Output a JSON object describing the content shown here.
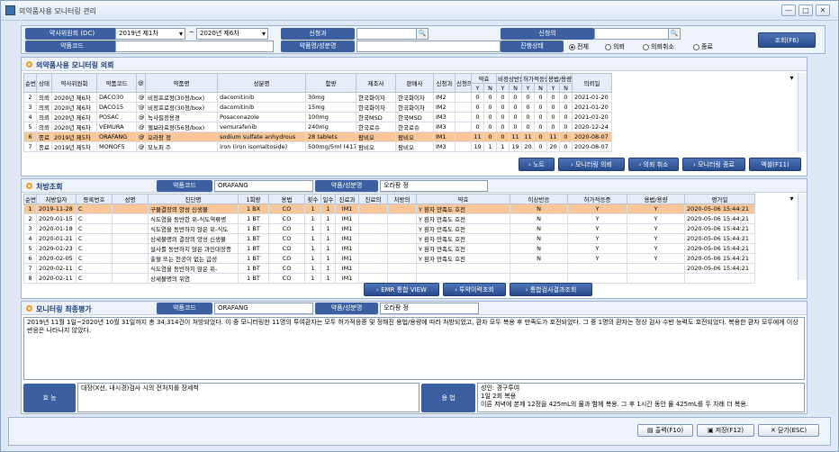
{
  "window": {
    "title": "의약품사용 모니터링 관리",
    "min": "—",
    "max": "□",
    "close": "✕"
  },
  "filter": {
    "dept_label": "약사위원회 (DC)",
    "period_from": "2019년 제1차",
    "period_to": "2020년 제6차",
    "tilde": "~",
    "applicant_dept_label": "신청과",
    "applicant_label": "신청의",
    "code_label": "약품코드",
    "name_label": "약품명/성분명",
    "status_label": "진행상태",
    "radios": [
      "전체",
      "의뢰",
      "의뢰취소",
      "종료"
    ],
    "query_btn": "조회(F6)"
  },
  "monitoring": {
    "title": "의약품사용 모니터링 의뢰",
    "headers": [
      "순번",
      "상태",
      "약사위원회",
      "약품코드",
      "@",
      "약품명",
      "성분명",
      "함량",
      "제조사",
      "판매사",
      "신청과",
      "신청의",
      "약효",
      "",
      "비정상반응",
      "",
      "허가적응증",
      "",
      "용법/용량",
      "",
      "의뢰일"
    ],
    "subheaders": [
      "Y",
      "N",
      "Y",
      "N",
      "Y",
      "N",
      "Y",
      "N"
    ],
    "rows": [
      [
        "2",
        "의뢰",
        "2020년 제6차",
        "DACO30",
        "@",
        "비정프로정(30정/box)",
        "dacomitinib",
        "30mg",
        "한국화이자",
        "한국화이자",
        "IM2",
        "",
        "0",
        "0",
        "0",
        "0",
        "0",
        "0",
        "0",
        "0",
        "2021-01-20"
      ],
      [
        "3",
        "의뢰",
        "2020년 제6차",
        "DACO15",
        "@",
        "비정프로정(30정/box)",
        "dacomitinib",
        "15mg",
        "한국화이자",
        "한국화이자",
        "IM2",
        "",
        "0",
        "0",
        "0",
        "0",
        "0",
        "0",
        "0",
        "0",
        "2021-01-20"
      ],
      [
        "4",
        "의뢰",
        "2020년 제6차",
        "POSAC",
        "@",
        "녹사필정용경",
        "Posaconazole",
        "100mg",
        "한국MSD",
        "한국MSD",
        "IM3",
        "",
        "0",
        "0",
        "0",
        "0",
        "0",
        "0",
        "0",
        "0",
        "2021-01-20"
      ],
      [
        "5",
        "의뢰",
        "2020년 제6차",
        "VEMURA",
        "@",
        "젤보라프정(56정/box)",
        "vemurafenib",
        "240mg",
        "한국로슈",
        "한국로슈",
        "IM3",
        "",
        "0",
        "0",
        "0",
        "0",
        "0",
        "0",
        "0",
        "0",
        "2020-12-24"
      ],
      [
        "6",
        "종료",
        "2019년 제5차",
        "ORAFANG",
        "@",
        "오라팡 정",
        "sodium sulfate anhydrous",
        "28 tablets",
        "팜비오",
        "팜비오",
        "IM1",
        "",
        "11",
        "0",
        "0",
        "11",
        "11",
        "0",
        "11",
        "0",
        "2020-08-07"
      ],
      [
        "7",
        "종료",
        "2019년 제5차",
        "MONOF5",
        "@",
        "모노퍼 주",
        "iron (iron isomaltoside)",
        "500mg/5ml (417mg",
        "팜비오",
        "팜비오",
        "IM3",
        "",
        "19",
        "1",
        "1",
        "19",
        "20",
        "0",
        "20",
        "0",
        "2020-08-07"
      ]
    ],
    "buttons": [
      "› 노트",
      "› 모니터링 의뢰",
      "› 의뢰 취소",
      "› 모니터링 종료",
      "엑셀(F11)"
    ]
  },
  "prescription": {
    "title": "처방조회",
    "code_label": "약품코드",
    "code_val": "ORAFANG",
    "name_label": "약품/성분명",
    "name_val": "오라팡 정",
    "headers": [
      "순번",
      "처방일자",
      "등록번호",
      "성명",
      "진단명",
      "1회량",
      "용법",
      "횟수",
      "일수",
      "진료과",
      "진료의",
      "처방의",
      "약효",
      "이상반응",
      "허가적응증",
      "용법/용량",
      "평가일"
    ],
    "rows": [
      [
        "1",
        "2019-11-28",
        "C",
        "",
        "구물결장의 양성 신생물",
        "1 BX",
        "CO",
        "1",
        "1",
        "IM1",
        "",
        "",
        "Y 환자 만족도 호전",
        "N",
        "Y",
        "Y",
        "2020-05-06 15:44:21"
      ],
      [
        "2",
        "2020-01-15",
        "C",
        "",
        "식도염을 동반한 위-식도역류병",
        "1 BT",
        "CO",
        "1",
        "1",
        "IM1",
        "",
        "",
        "Y 환자 만족도 호전",
        "N",
        "Y",
        "Y",
        "2020-05-06 15:44:21"
      ],
      [
        "3",
        "2020-01-18",
        "C",
        "",
        "식도염을 동반하지 않은 위-식도",
        "1 BT",
        "CO",
        "1",
        "1",
        "IM1",
        "",
        "",
        "Y 환자 만족도 호전",
        "N",
        "Y",
        "Y",
        "2020-05-06 15:44:21"
      ],
      [
        "4",
        "2020-01-21",
        "C",
        "",
        "상세불명의 결장의 양성 신생물",
        "1 BT",
        "CO",
        "1",
        "1",
        "IM1",
        "",
        "",
        "Y 환자 만족도 호전",
        "N",
        "Y",
        "Y",
        "2020-05-06 15:44:21"
      ],
      [
        "5",
        "2020-01-23",
        "C",
        "",
        "설사를 동반하지 않은 과민대장증",
        "1 BT",
        "CO",
        "1",
        "1",
        "IM1",
        "",
        "",
        "Y 환자 만족도 호전",
        "N",
        "Y",
        "Y",
        "2020-05-06 15:44:21"
      ],
      [
        "6",
        "2020-02-05",
        "C",
        "",
        "출혈 또는 천공이 없는 급성",
        "1 BT",
        "CO",
        "1",
        "1",
        "IM1",
        "",
        "",
        "Y 환자 만족도 호전",
        "N",
        "Y",
        "Y",
        "2020-05-06 15:44:21"
      ],
      [
        "7",
        "2020-02-11",
        "C",
        "",
        "식도염을 동반하지 않은 위-",
        "1 BT",
        "CO",
        "1",
        "1",
        "IM1",
        "",
        "",
        "",
        "",
        "",
        "",
        "2020-05-06 15:44:21"
      ],
      [
        "8",
        "2020-02-11",
        "C",
        "",
        "상세불명의 위염",
        "1 BT",
        "CO",
        "1",
        "1",
        "IM1",
        "",
        "",
        "",
        "",
        "",
        "",
        ""
      ]
    ],
    "buttons": [
      "› EMR 통합 VIEW",
      "› 투약이력조회",
      "› 통합검사결과조회"
    ]
  },
  "evaluation": {
    "title": "모니터링 최종평가",
    "code_label": "약품코드",
    "code_val": "ORAFANG",
    "name_label": "약품/성분명",
    "name_val": "오라팡 정",
    "text": "2019년 11월 1일~2020년 10월 31일까지 총 34,314건이 처방되었다. 이 중 모니터링한 11명의 투여환자는 모두 허가적응증 및 정해진 용법/용량에 따라 처방되었고, 환자 모두 복용 후 만족도가 호전되었다. 그 중 1명의 환자는 정상 검사 수반 능력도 호전되었다. 복용한 환자 모두에게 이상 반응은 나타나지 않았다.",
    "efficacy_label": "효 능",
    "efficacy_text": "대장(X선, 내시경)검사 시의 전처치를 장세척",
    "usage_label": "용 법",
    "usage_text": "성인: 경구투여\n1일 2회 복용\n이른 저녁에 본제 12정을 425mL의 물과 함께 복용. 그 후 1시간 동안 물 425mL를 두 차례 더 복용."
  },
  "footer": {
    "print": "출력(F10)",
    "save": "저장(F12)",
    "close": "닫기(ESC)"
  }
}
